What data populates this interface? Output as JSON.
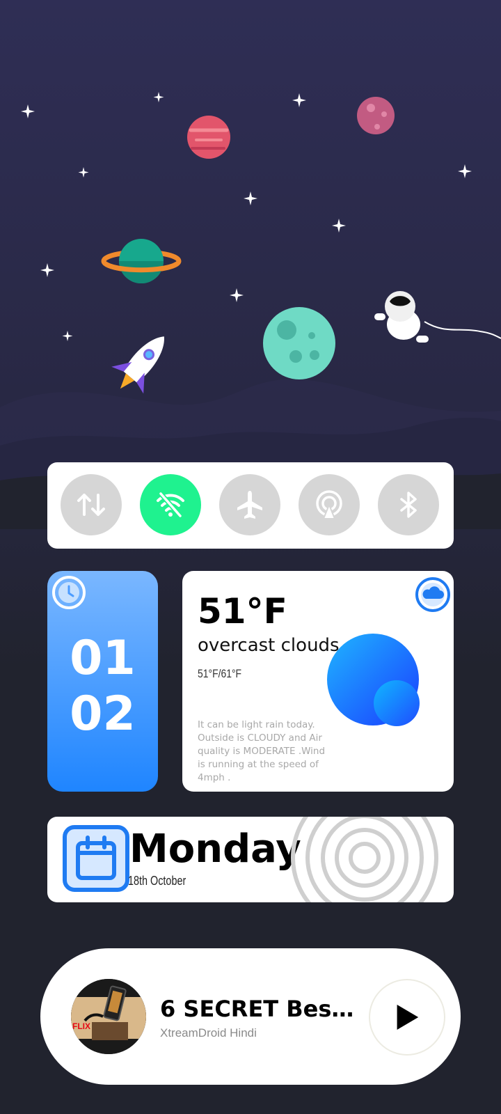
{
  "quick_toggles": [
    {
      "name": "mobile-data-toggle",
      "icon": "data-arrows-icon",
      "on": false
    },
    {
      "name": "wifi-toggle",
      "icon": "wifi-off-icon",
      "on": true
    },
    {
      "name": "airplane-mode-toggle",
      "icon": "airplane-icon",
      "on": false
    },
    {
      "name": "hotspot-toggle",
      "icon": "hotspot-icon",
      "on": false
    },
    {
      "name": "bluetooth-toggle",
      "icon": "bluetooth-icon",
      "on": false
    }
  ],
  "clock": {
    "hour": "01",
    "minute": "02",
    "icon": "alarm-clock-icon"
  },
  "weather": {
    "temp": "51°F",
    "condition": "overcast clouds",
    "range": "51°F/61°F",
    "info": "It can be light rain today. Outside is CLOUDY and Air quality is MODERATE .Wind is running at the speed of 4mph .",
    "icon": "cloud-icon"
  },
  "date": {
    "day": "Monday",
    "date_text": "18th October",
    "icon": "calendar-icon"
  },
  "media": {
    "title": "6 SECRET Best ...",
    "artist": "XtreamDroid Hindi",
    "thumbnail_text": "FLIX",
    "play_icon": "play-icon"
  },
  "colors": {
    "toggle_on": "#1ff28f",
    "toggle_off": "#d6d6d6",
    "clock_gradient_top": "#7ab7ff",
    "clock_gradient_bottom": "#1f85ff",
    "accent_blue": "#1f7bf2",
    "background": "#21232e"
  }
}
